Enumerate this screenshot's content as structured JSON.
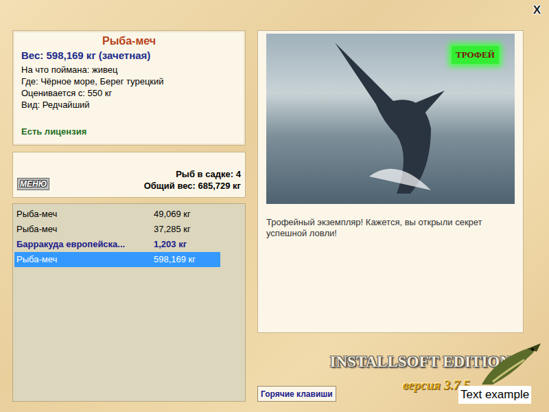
{
  "window": {
    "close": "X"
  },
  "fish_info": {
    "name": "Рыба-меч",
    "weight": "Вес: 598,169 кг (зачетная)",
    "details": [
      "На что поймана: живец",
      "Где: Чёрное море, Берег турецкий",
      "Оценивается с: 550 кг",
      "Вид: Редчайший"
    ],
    "license": "Есть лицензия"
  },
  "keepnet": {
    "menu_button": "МЕНЮ",
    "count": "Рыб в садке: 4",
    "total": "Общий вес: 685,729 кг"
  },
  "catch_list": [
    {
      "name": "Рыба-меч",
      "weight": "49,069 кг",
      "highlighted": false,
      "selected": false
    },
    {
      "name": "Рыба-меч",
      "weight": "37,285 кг",
      "highlighted": false,
      "selected": false
    },
    {
      "name": "Барракуда европейска...",
      "weight": "1,203 кг",
      "highlighted": true,
      "selected": false
    },
    {
      "name": "Рыба-меч",
      "weight": "598,169 кг",
      "highlighted": false,
      "selected": true
    }
  ],
  "trophy": {
    "badge": "ТРОФЕЙ",
    "message": "Трофейный экземпляр! Кажется, вы открыли секрет успешной ловли!"
  },
  "hotkeys_button": "Горячие клавиши",
  "logo": {
    "title": "INSTALLSOFT EDITION",
    "version": "версия 3.7.5"
  },
  "label": "Text example"
}
